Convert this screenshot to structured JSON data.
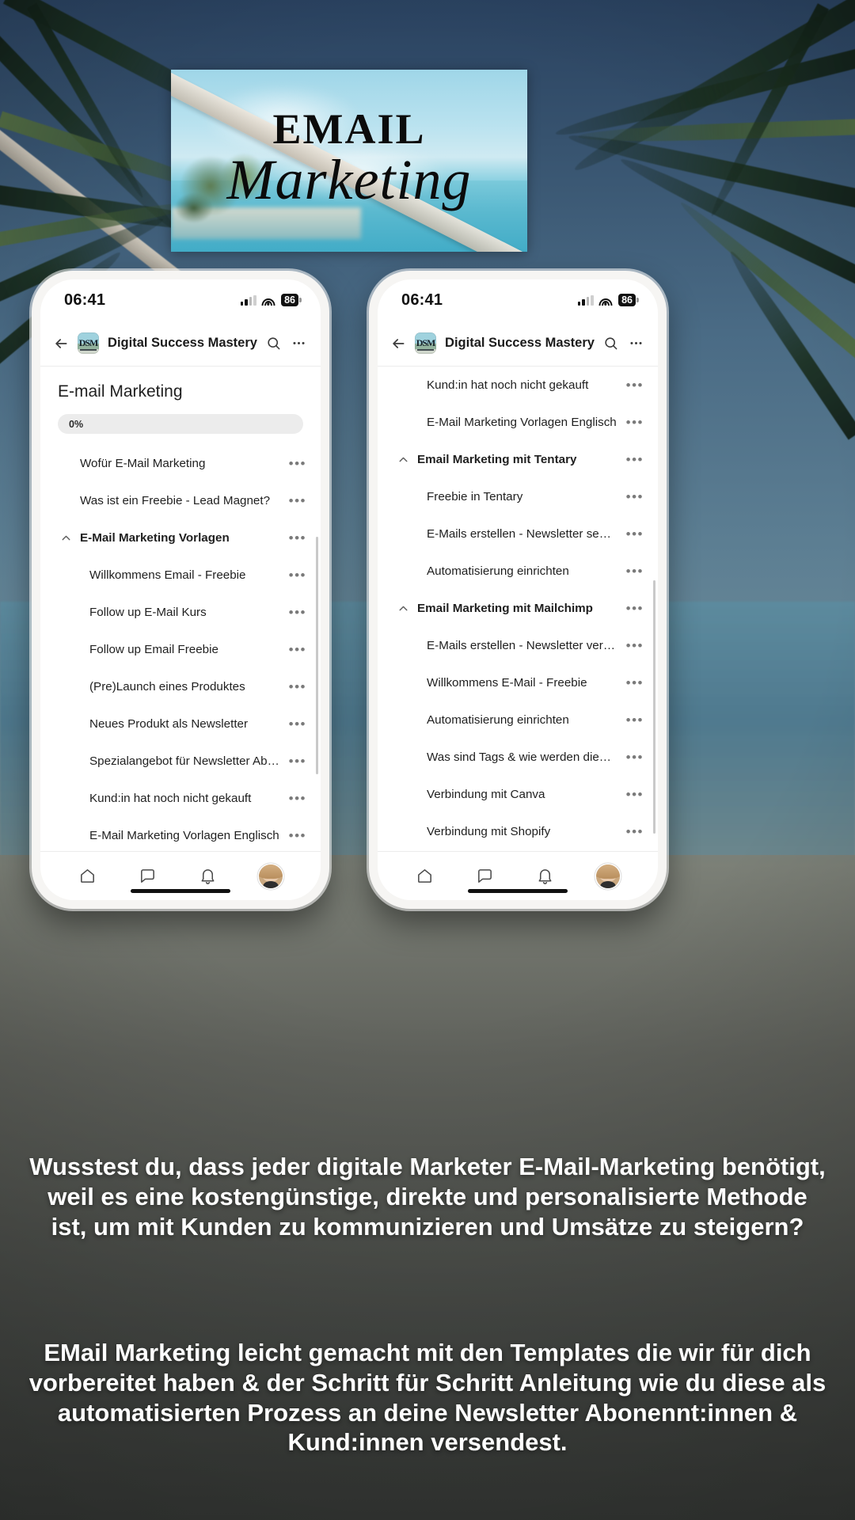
{
  "banner": {
    "title_first_letter": "E",
    "title_rest": "MAIL",
    "title_full": "EMAIL",
    "script_word": "Marketing"
  },
  "status_bar": {
    "time": "06:41",
    "battery": "86",
    "signal_icon": "cellular-signal-icon",
    "wifi_icon": "wifi-icon",
    "battery_icon": "battery-icon"
  },
  "app_header": {
    "back_icon": "back-arrow-icon",
    "logo_text": "DSM",
    "title": "Digital Success Mastery",
    "search_icon": "search-icon",
    "more_icon": "more-options-icon"
  },
  "bottom_nav": {
    "home_icon": "home-icon",
    "chat_icon": "chat-bubble-icon",
    "bell_icon": "notification-bell-icon",
    "avatar_icon": "user-avatar-icon"
  },
  "left_phone": {
    "course_title": "E-mail Marketing",
    "progress_label": "0%",
    "progress_percent": 0,
    "items": [
      {
        "label": "Wofür E-Mail Marketing",
        "type": "item",
        "menu": "•••"
      },
      {
        "label": "Was ist ein Freebie - Lead Magnet?",
        "type": "item",
        "menu": "•••"
      },
      {
        "label": "E-Mail Marketing Vorlagen",
        "type": "section",
        "expanded": true,
        "menu": "•••"
      },
      {
        "label": "Willkommens Email - Freebie",
        "type": "sub",
        "menu": "•••"
      },
      {
        "label": "Follow up E-Mail Kurs",
        "type": "sub",
        "menu": "•••"
      },
      {
        "label": "Follow up Email Freebie",
        "type": "sub",
        "menu": "•••"
      },
      {
        "label": "(Pre)Launch eines Produktes",
        "type": "sub",
        "menu": "•••"
      },
      {
        "label": "Neues Produkt als Newsletter",
        "type": "sub",
        "menu": "•••"
      },
      {
        "label": "Spezialangebot für Newsletter Abo…",
        "type": "sub",
        "menu": "•••"
      },
      {
        "label": "Kund:in hat noch nicht gekauft",
        "type": "sub",
        "menu": "•••"
      },
      {
        "label": "E-Mail Marketing Vorlagen Englisch",
        "type": "sub",
        "menu": "•••"
      }
    ]
  },
  "right_phone": {
    "items": [
      {
        "label": "Kund:in hat noch nicht gekauft",
        "type": "sub",
        "menu": "•••"
      },
      {
        "label": "E-Mail Marketing Vorlagen Englisch",
        "type": "sub",
        "menu": "•••"
      },
      {
        "label": "Email Marketing mit Tentary",
        "type": "section",
        "expanded": true,
        "menu": "•••"
      },
      {
        "label": "Freebie in Tentary",
        "type": "sub",
        "menu": "•••"
      },
      {
        "label": "E-Mails erstellen - Newsletter send…",
        "type": "sub",
        "menu": "•••"
      },
      {
        "label": "Automatisierung einrichten",
        "type": "sub",
        "menu": "•••"
      },
      {
        "label": "Email Marketing mit Mailchimp",
        "type": "section",
        "expanded": true,
        "menu": "•••"
      },
      {
        "label": "E-Mails erstellen - Newsletter verse…",
        "type": "sub",
        "menu": "•••"
      },
      {
        "label": "Willkommens E-Mail - Freebie",
        "type": "sub",
        "menu": "•••"
      },
      {
        "label": "Automatisierung einrichten",
        "type": "sub",
        "menu": "•••"
      },
      {
        "label": "Was sind Tags & wie werden diese …",
        "type": "sub",
        "menu": "•••"
      },
      {
        "label": "Verbindung mit Canva",
        "type": "sub",
        "menu": "•••"
      },
      {
        "label": "Verbindung mit Shopify",
        "type": "sub",
        "menu": "•••"
      }
    ]
  },
  "caption": {
    "paragraph_1": "Wusstest du, dass jeder digitale Marketer E-Mail-Marketing benötigt, weil es eine kostengünstige, direkte und personalisierte Methode ist, um mit Kunden zu kommunizieren und Umsätze zu steigern?",
    "paragraph_2": "EMail Marketing leicht gemacht mit den Templates die wir für dich vorbereitet haben & der Schritt für Schritt Anleitung wie du diese als automatisierten Prozess an deine Newsletter Abonennt:innen & Kund:innen versendest."
  },
  "colors": {
    "text_primary": "#1f1f1f",
    "progress_track": "#ececec",
    "caption_text": "#ffffff",
    "banner_sky": "#9fd6e8"
  }
}
